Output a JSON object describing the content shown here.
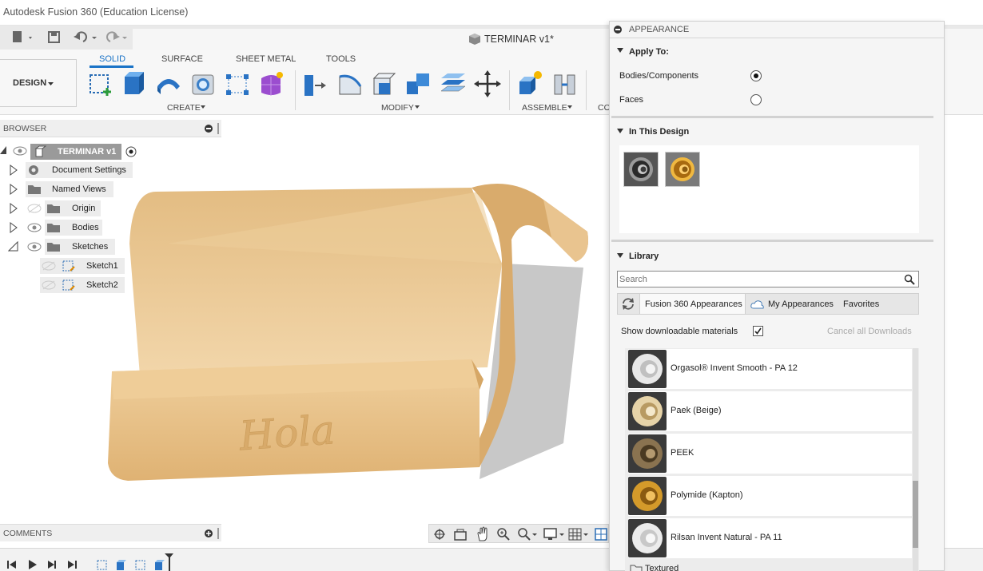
{
  "app": {
    "window_title": "Autodesk Fusion 360 (Education License)",
    "document_title": "TERMINAR v1*"
  },
  "ribbon": {
    "workspace": "DESIGN",
    "tabs": [
      "SOLID",
      "SURFACE",
      "SHEET METAL",
      "TOOLS"
    ],
    "active_tab": "SOLID",
    "groups": {
      "create": "CREATE",
      "modify": "MODIFY",
      "assemble": "ASSEMBLE",
      "construct": "CO"
    }
  },
  "browser": {
    "title": "BROWSER",
    "root": "TERMINAR v1",
    "items": [
      {
        "label": "Document Settings"
      },
      {
        "label": "Named Views"
      },
      {
        "label": "Origin"
      },
      {
        "label": "Bodies"
      },
      {
        "label": "Sketches"
      },
      {
        "label": "Sketch1"
      },
      {
        "label": "Sketch2"
      }
    ]
  },
  "comments": {
    "title": "COMMENTS"
  },
  "model": {
    "engraving": "Hola",
    "body_color": "#E6BC82"
  },
  "appearance_panel": {
    "title": "APPEARANCE",
    "apply_to": {
      "label": "Apply To:",
      "options": [
        {
          "label": "Bodies/Components",
          "selected": true
        },
        {
          "label": "Faces",
          "selected": false
        }
      ]
    },
    "in_this_design": {
      "label": "In This Design",
      "swatches": [
        "chrome-material",
        "gold-material"
      ]
    },
    "library": {
      "label": "Library",
      "search_placeholder": "Search",
      "tabs": [
        "Fusion 360 Appearances",
        "My Appearances",
        "Favorites"
      ],
      "show_downloadable_label": "Show downloadable materials",
      "show_downloadable_checked": true,
      "cancel_downloads": "Cancel all Downloads",
      "materials": [
        {
          "name": "Orgasol® Invent Smooth - PA 12",
          "color": "#e8e8e8"
        },
        {
          "name": "Paek (Beige)",
          "color": "#e6d3a8"
        },
        {
          "name": "PEEK",
          "color": "#8a7350"
        },
        {
          "name": "Polymide (Kapton)",
          "color": "#d49a2a"
        },
        {
          "name": "Rilsan Invent Natural - PA 11",
          "color": "#ececec"
        }
      ],
      "folder_partial": "Textured"
    }
  },
  "colors": {
    "accent": "#1a73c7"
  }
}
